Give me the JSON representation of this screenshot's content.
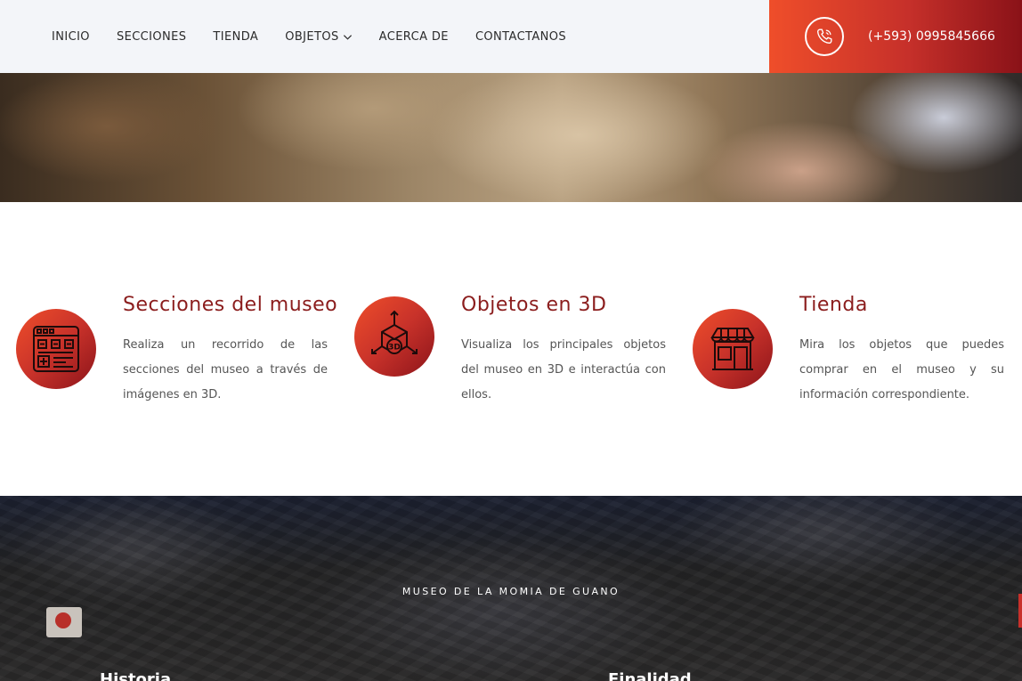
{
  "nav": {
    "items": [
      {
        "label": "INICIO"
      },
      {
        "label": "SECCIONES"
      },
      {
        "label": "TIENDA"
      },
      {
        "label": "OBJETOS"
      },
      {
        "label": "ACERCA DE"
      },
      {
        "label": "CONTACTANOS"
      }
    ],
    "phone": "(+593) 0995845666"
  },
  "features": [
    {
      "title": "Secciones del museo",
      "description": "Realiza un recorrido de las secciones del museo a través de imágenes en 3D.",
      "icon": "browser-grid-icon"
    },
    {
      "title": "Objetos en 3D",
      "description": "Visualiza los principales objetos del museo en 3D e interactúa con ellos.",
      "icon": "cube-3d-icon"
    },
    {
      "title": "Tienda",
      "description": "Mira los objetos que puedes comprar en el museo y su información correspondiente.",
      "icon": "storefront-icon"
    }
  ],
  "about": {
    "kicker": "MUSEO DE LA MOMIA DE GUANO",
    "columns": [
      {
        "title": "Historia"
      },
      {
        "title": "Finalidad"
      }
    ]
  },
  "colors": {
    "accent_start": "#ef4e2a",
    "accent_end": "#8a1218",
    "title_color": "#8b1d1d"
  }
}
